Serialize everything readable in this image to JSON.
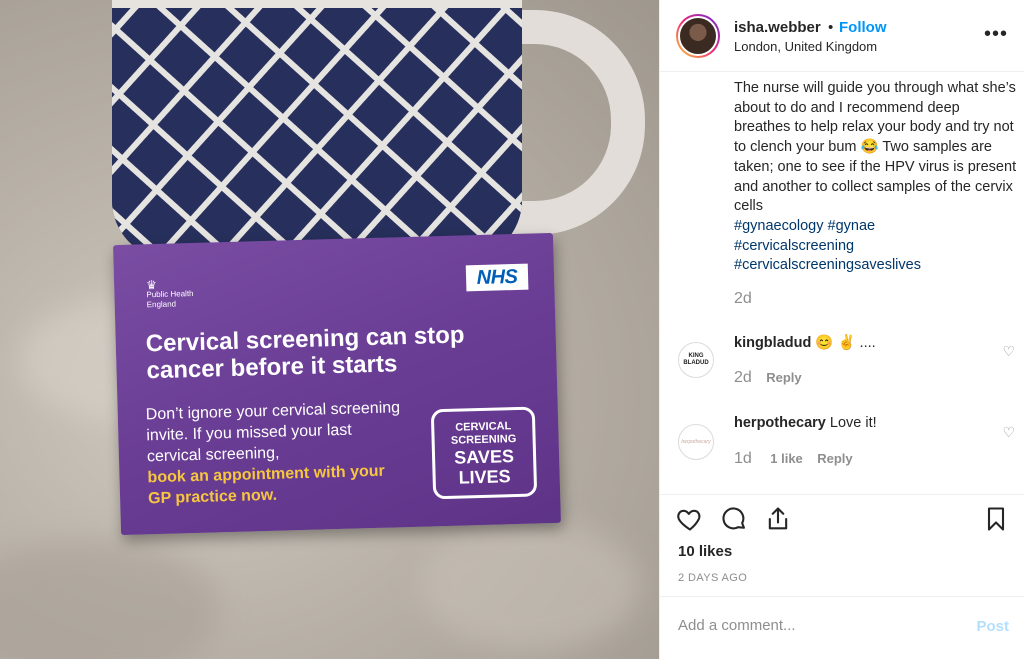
{
  "post": {
    "username": "isha.webber",
    "separator": "•",
    "follow_label": "Follow",
    "location": "London, United Kingdom",
    "more_icon": "more-horizontal-icon"
  },
  "photo": {
    "card": {
      "org": "Public Health England",
      "nhs_logo": "NHS",
      "headline": "Cervical screening can stop cancer before it starts",
      "body": "Don’t ignore your cervical screening invite. If you missed your last cervical screening,",
      "cta": "book an appointment with your GP practice now.",
      "stamp_line1": "CERVICAL SCREENING",
      "stamp_line2": "SAVES LIVES"
    }
  },
  "caption": {
    "text": "The nurse will guide you through what she’s about to do and I recommend deep breathes to help relax your body and try not to clench your bum 😂 Two samples are taken; one to see if the HPV virus is present and another to collect samples of the cervix cells",
    "hashtags": [
      "#gynaecology #gynae",
      "#cervicalscreening",
      "#cervicalscreeningsaveslives"
    ],
    "time": "2d"
  },
  "comments": [
    {
      "avatar_text": "KING BLADUD",
      "user": "kingbladud",
      "text": "😊 ✌ ....",
      "time": "2d",
      "likes": "",
      "reply_label": "Reply"
    },
    {
      "avatar_text": "herpothecary",
      "user": "herpothecary",
      "text": "Love it!",
      "time": "1d",
      "likes": "1 like",
      "reply_label": "Reply"
    }
  ],
  "actions": {
    "likes": "10 likes",
    "date": "2 DAYS AGO"
  },
  "comment_box": {
    "placeholder": "Add a comment...",
    "post_label": "Post"
  },
  "colors": {
    "accent": "#0095f6",
    "post_disabled": "#b2dffc",
    "card_purple": "#6a3d95",
    "card_yellow": "#f7c640",
    "nhs_blue": "#005eb8"
  }
}
